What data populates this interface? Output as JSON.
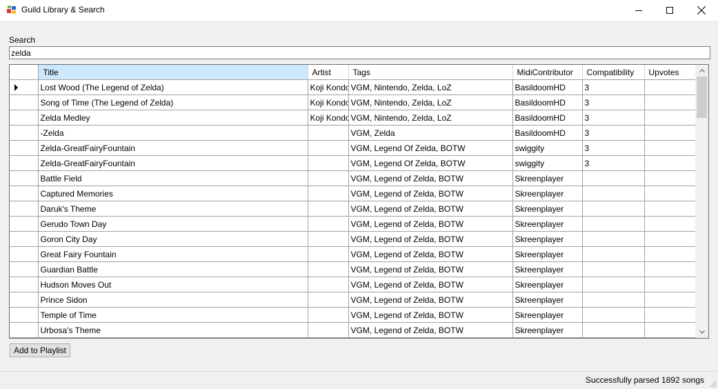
{
  "window": {
    "title": "Guild Library & Search",
    "controls": {
      "minimize": "minimize-icon",
      "maximize": "maximize-icon",
      "close": "close-icon"
    }
  },
  "search": {
    "label": "Search",
    "value": "zelda"
  },
  "grid": {
    "columns": [
      "Title",
      "Artist",
      "Tags",
      "MidiContributor",
      "Compatibility",
      "Upvotes"
    ],
    "selected_column": "Title",
    "rows": [
      [
        "Lost Wood (The Legend of Zelda)",
        "Koji Kondo",
        "VGM, Nintendo, Zelda, LoZ",
        "BasildoomHD",
        "3",
        ""
      ],
      [
        "Song of Time (The Legend of Zelda)",
        "Koji Kondo",
        "VGM, Nintendo, Zelda, LoZ",
        "BasildoomHD",
        "3",
        ""
      ],
      [
        "Zelda Medley",
        "Koji Kondo",
        "VGM, Nintendo, Zelda, LoZ",
        "BasildoomHD",
        "3",
        ""
      ],
      [
        "-Zelda",
        "",
        "VGM, Zelda",
        "BasildoomHD",
        "3",
        ""
      ],
      [
        "Zelda-GreatFairyFountain",
        "",
        "VGM, Legend Of Zelda, BOTW",
        "swiggity",
        "3",
        ""
      ],
      [
        "Zelda-GreatFairyFountain",
        "",
        "VGM, Legend Of Zelda, BOTW",
        "swiggity",
        "3",
        ""
      ],
      [
        "Battle Field",
        "",
        "VGM, Legend of Zelda, BOTW",
        "Skreenplayer",
        "",
        ""
      ],
      [
        "Captured Memories",
        "",
        "VGM, Legend of Zelda, BOTW",
        "Skreenplayer",
        "",
        ""
      ],
      [
        "Daruk's Theme",
        "",
        "VGM, Legend of Zelda, BOTW",
        "Skreenplayer",
        "",
        ""
      ],
      [
        "Gerudo Town Day",
        "",
        "VGM, Legend of Zelda, BOTW",
        "Skreenplayer",
        "",
        ""
      ],
      [
        "Goron City Day",
        "",
        "VGM, Legend of Zelda, BOTW",
        "Skreenplayer",
        "",
        ""
      ],
      [
        "Great Fairy Fountain",
        "",
        "VGM, Legend of Zelda, BOTW",
        "Skreenplayer",
        "",
        ""
      ],
      [
        "Guardian Battle",
        "",
        "VGM, Legend of Zelda, BOTW",
        "Skreenplayer",
        "",
        ""
      ],
      [
        "Hudson Moves Out",
        "",
        "VGM, Legend of Zelda, BOTW",
        "Skreenplayer",
        "",
        ""
      ],
      [
        "Prince Sidon",
        "",
        "VGM, Legend of Zelda, BOTW",
        "Skreenplayer",
        "",
        ""
      ],
      [
        "Temple of Time",
        "",
        "VGM, Legend of Zelda, BOTW",
        "Skreenplayer",
        "",
        ""
      ],
      [
        "Urbosa's Theme",
        "",
        "VGM, Legend of Zelda, BOTW",
        "Skreenplayer",
        "",
        ""
      ],
      [
        "",
        "",
        "",
        "",
        "",
        ""
      ]
    ],
    "current_row": 0
  },
  "buttons": {
    "add_to_playlist": "Add to Playlist"
  },
  "status": {
    "text": "Successfully parsed 1892 songs"
  }
}
